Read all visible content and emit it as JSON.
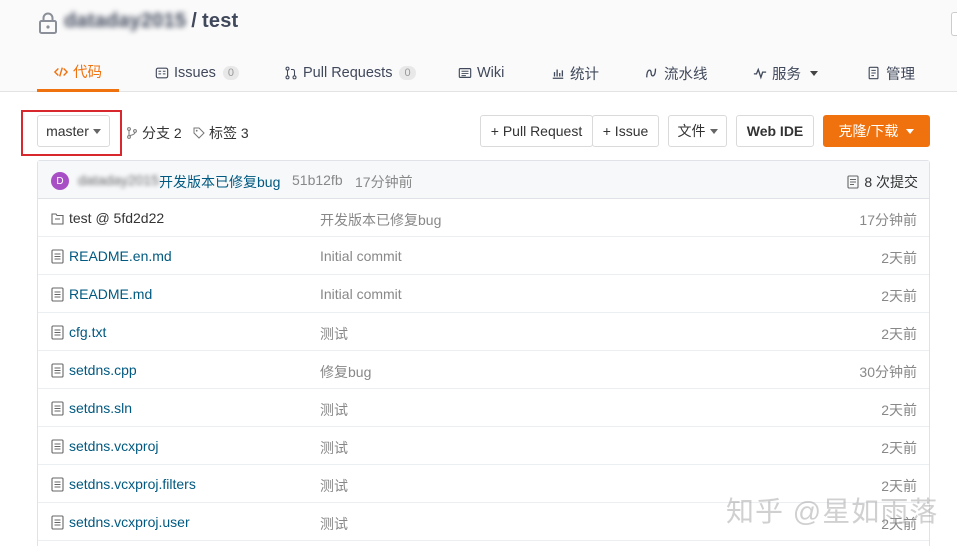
{
  "header": {
    "owner": "dataday2015",
    "separator": "/",
    "repo": "test"
  },
  "tabs": [
    {
      "label": "代码",
      "icon": "code-icon",
      "active": true
    },
    {
      "label": "Issues",
      "icon": "issues-icon",
      "badge": "0"
    },
    {
      "label": "Pull Requests",
      "icon": "pull-request-icon",
      "badge": "0"
    },
    {
      "label": "Wiki",
      "icon": "wiki-icon"
    },
    {
      "label": "统计",
      "icon": "stats-icon"
    },
    {
      "label": "流水线",
      "icon": "pipeline-icon"
    },
    {
      "label": "服务",
      "icon": "service-icon",
      "dropdown": true
    },
    {
      "label": "管理",
      "icon": "manage-icon"
    }
  ],
  "toolbar": {
    "branch": "master",
    "branches": "分支 2",
    "tags": "标签 3",
    "pull_request": "+ Pull Request",
    "issue": "+ Issue",
    "file": "文件",
    "web_ide": "Web IDE",
    "clone": "克隆/下载"
  },
  "last_commit": {
    "avatar_letter": "D",
    "author": "dataday2015",
    "message": "开发版本已修复bug",
    "hash": "51b12fb",
    "time": "17分钟前",
    "count": "8 次提交"
  },
  "files": [
    {
      "name": "test @ 5fd2d22",
      "type": "submodule",
      "message": "开发版本已修复bug",
      "time": "17分钟前"
    },
    {
      "name": "README.en.md",
      "type": "file",
      "message": "Initial commit",
      "time": "2天前"
    },
    {
      "name": "README.md",
      "type": "file",
      "message": "Initial commit",
      "time": "2天前"
    },
    {
      "name": "cfg.txt",
      "type": "file",
      "message": "测试",
      "time": "2天前"
    },
    {
      "name": "setdns.cpp",
      "type": "file",
      "message": "修复bug",
      "time": "30分钟前"
    },
    {
      "name": "setdns.sln",
      "type": "file",
      "message": "测试",
      "time": "2天前"
    },
    {
      "name": "setdns.vcxproj",
      "type": "file",
      "message": "测试",
      "time": "2天前"
    },
    {
      "name": "setdns.vcxproj.filters",
      "type": "file",
      "message": "测试",
      "time": "2天前"
    },
    {
      "name": "setdns.vcxproj.user",
      "type": "file",
      "message": "测试",
      "time": "2天前"
    }
  ],
  "watermark": "知乎 @星如雨落",
  "colors": {
    "accent": "#f0720f",
    "link": "#005980",
    "highlight": "#d8282d"
  }
}
